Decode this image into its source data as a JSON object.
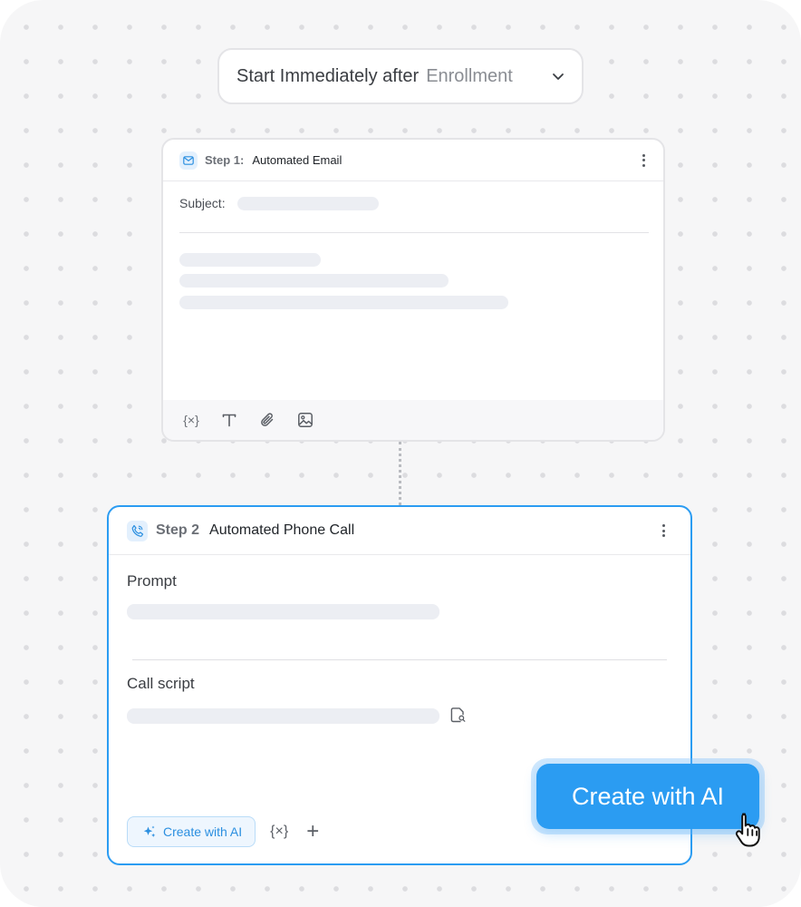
{
  "trigger": {
    "label": "Start Immediately after",
    "value": "Enrollment"
  },
  "step1": {
    "label": "Step 1:",
    "title": "Automated Email",
    "subject_label": "Subject:",
    "toolbar": {
      "variable_label": "{×}"
    }
  },
  "step2": {
    "label": "Step 2",
    "title": "Automated Phone Call",
    "prompt_label": "Prompt",
    "call_script_label": "Call script",
    "create_ai_label": "Create with AI",
    "variable_label": "{×}",
    "add_label": "+"
  },
  "cta": {
    "label": "Create with AI"
  },
  "colors": {
    "accent": "#2b9cf2",
    "badge_bg": "#e3f0fd",
    "skeleton": "#eceef3"
  }
}
